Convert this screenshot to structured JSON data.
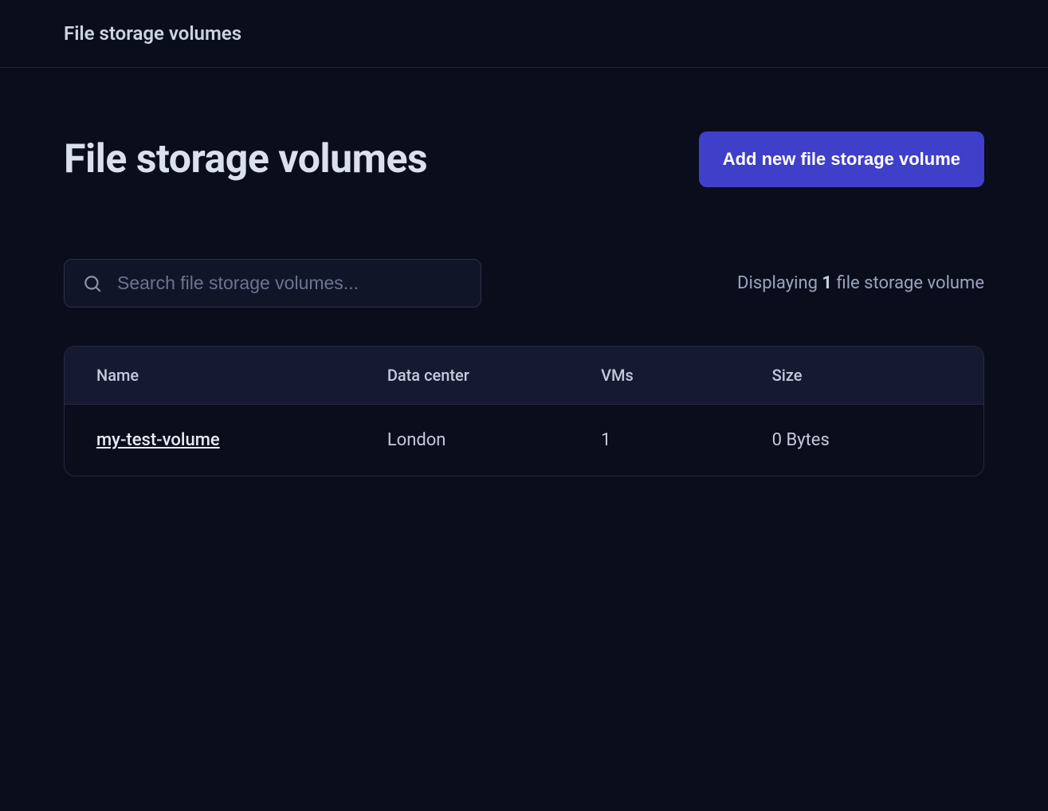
{
  "breadcrumb": "File storage volumes",
  "page_title": "File storage volumes",
  "add_button_label": "Add new file storage volume",
  "search": {
    "placeholder": "Search file storage volumes..."
  },
  "count": {
    "prefix": "Displaying ",
    "number": "1",
    "suffix": " file storage volume"
  },
  "table": {
    "headers": {
      "name": "Name",
      "data_center": "Data center",
      "vms": "VMs",
      "size": "Size"
    },
    "rows": [
      {
        "name": "my-test-volume",
        "data_center": "London",
        "vms": "1",
        "size": "0 Bytes"
      }
    ]
  }
}
